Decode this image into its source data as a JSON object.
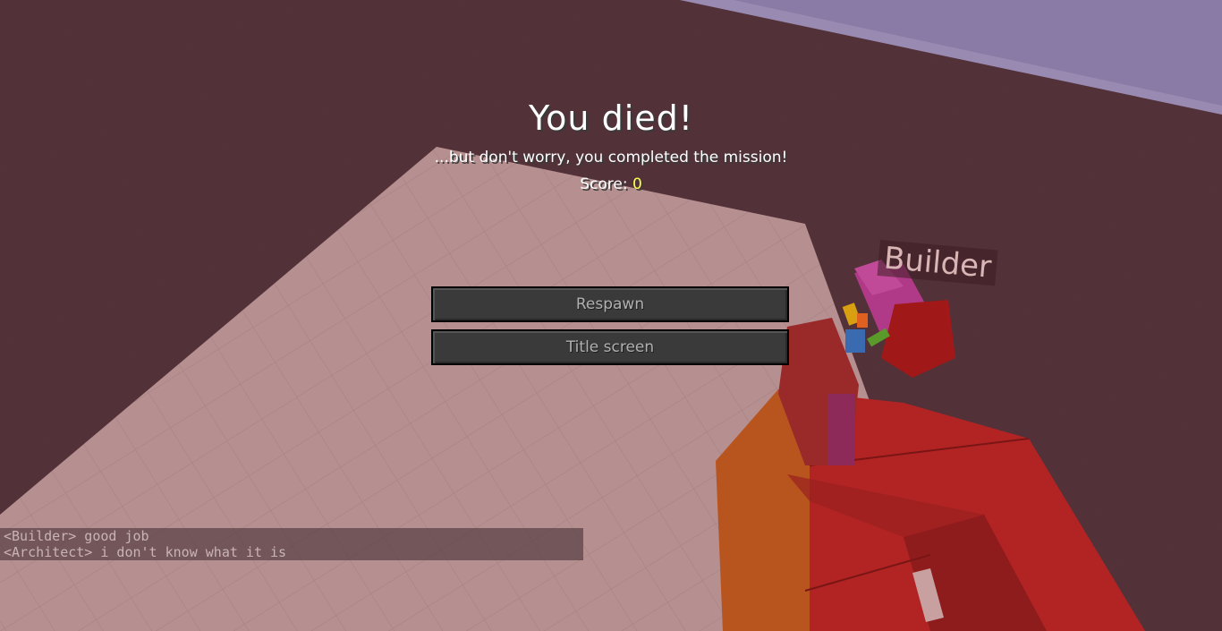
{
  "death_screen": {
    "title": "You died!",
    "subtitle": "...but don't worry, you completed the mission!",
    "score_label": "Score: ",
    "score_value": "0",
    "buttons": {
      "respawn": "Respawn",
      "title_screen": "Title screen"
    }
  },
  "chat": {
    "messages": [
      "<Builder> good job",
      "<Architect> i don't know what it is"
    ]
  },
  "world": {
    "player_nametag": "Builder"
  },
  "colors": {
    "score": "#ffff55",
    "button_bg": "#3a3a3a",
    "button_text": "#b0b0b0",
    "floor": "#b68f90",
    "block_red": "#a82020",
    "sky": "#8a7aa6"
  }
}
